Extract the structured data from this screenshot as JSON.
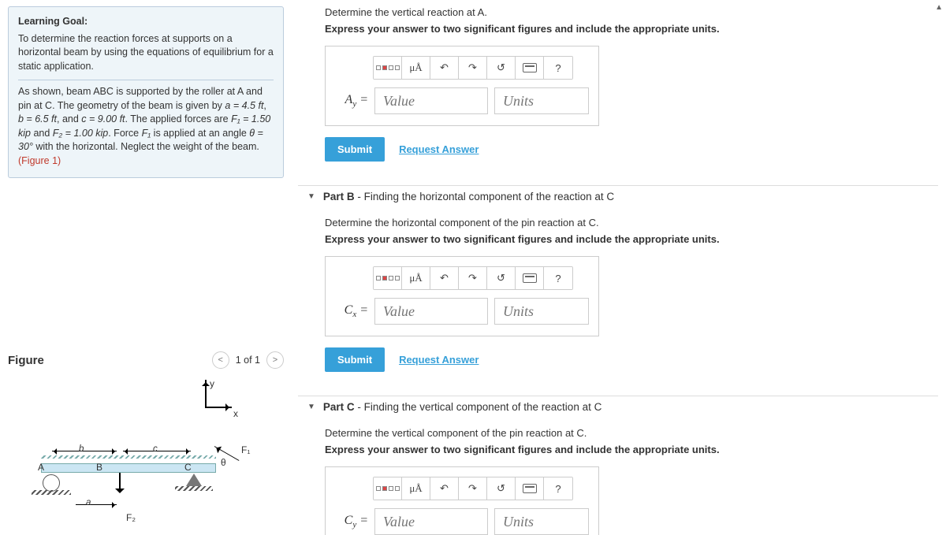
{
  "goal": {
    "title": "Learning Goal:",
    "desc": "To determine the reaction forces at supports on a horizontal beam by using the equations of equilibrium for a static application.",
    "body_pre": "As shown, beam ABC is supported by the roller at A and pin at C. The geometry of the beam is given by ",
    "a_eq": "a = 4.5 ft",
    "b_eq": "b = 6.5 ft",
    "and1": ", and ",
    "c_eq": "c = 9.00 ft",
    "mid1": ". The applied forces are ",
    "F1_eq": "F₁ = 1.50 kip",
    "and2": " and ",
    "F2_eq": "F₂ = 1.00 kip",
    "mid2": ". Force ",
    "F1v": "F₁",
    "mid3": " is applied at an angle ",
    "theta_eq": "θ = 30°",
    "mid4": " with the horizontal. Neglect the weight of the beam.",
    "figlink": "(Figure 1)"
  },
  "figure": {
    "title": "Figure",
    "pager": "1 of 1",
    "ylbl": "y",
    "xlbl": "x",
    "A": "A",
    "B": "B",
    "C": "C",
    "b": "b",
    "c": "c",
    "a": "a",
    "F1": "F₁",
    "theta": "θ",
    "F2": "F₂"
  },
  "partA": {
    "prompt": "Determine the vertical reaction at A.",
    "instr": "Express your answer to two significant figures and include the appropriate units.",
    "var": "A",
    "sub": "y",
    "eq": " = ",
    "value_ph": "Value",
    "units_ph": "Units"
  },
  "partB": {
    "header": "Part B - Finding the horizontal component of the reaction at C",
    "header_b": "Part B",
    "header_rest": " - Finding the horizontal component of the reaction at C",
    "prompt": "Determine the horizontal component of the pin reaction at C.",
    "instr": "Express your answer to two significant figures and include the appropriate units.",
    "var": "C",
    "sub": "x",
    "eq": " = ",
    "value_ph": "Value",
    "units_ph": "Units"
  },
  "partC": {
    "header_b": "Part C",
    "header_rest": " - Finding the vertical component of the reaction at C",
    "prompt": "Determine the vertical component of the pin reaction at C.",
    "instr": "Express your answer to two significant figures and include the appropriate units.",
    "var": "C",
    "sub": "y",
    "eq": " = ",
    "value_ph": "Value",
    "units_ph": "Units"
  },
  "common": {
    "submit": "Submit",
    "request": "Request Answer",
    "muA": "μÅ",
    "undo": "↶",
    "redo": "↷",
    "reset": "↺",
    "help": "?"
  }
}
